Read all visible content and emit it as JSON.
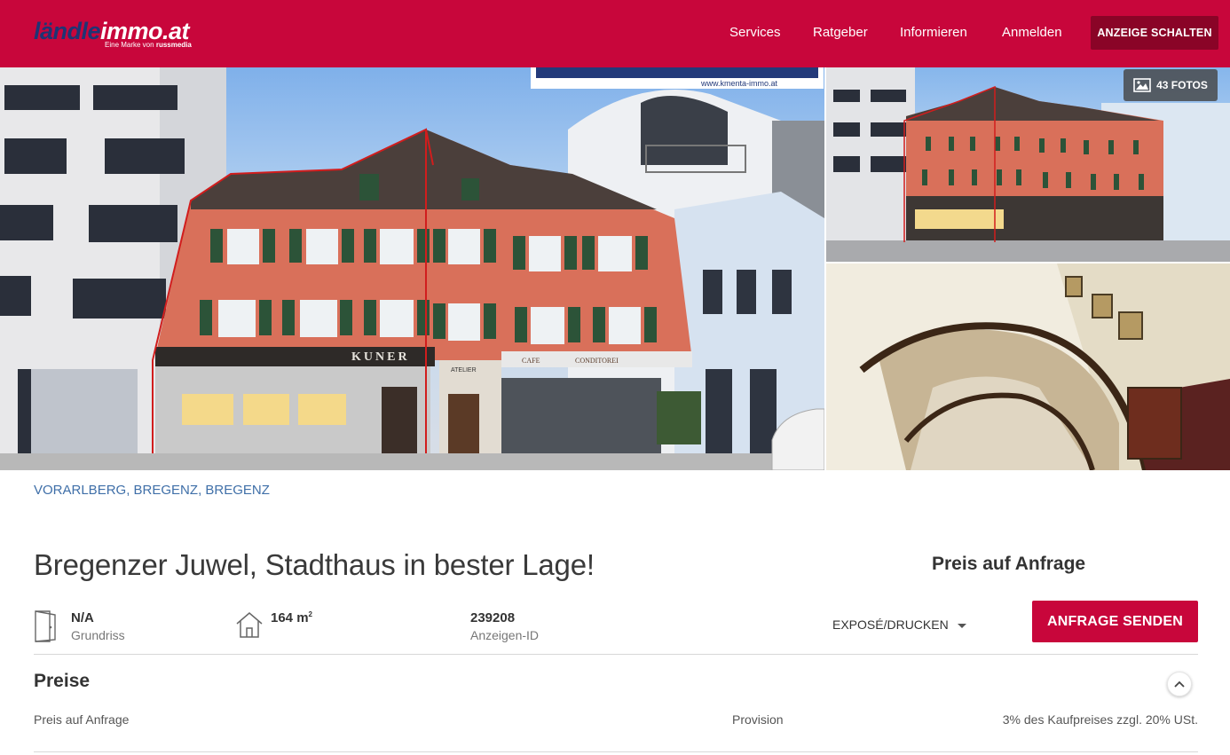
{
  "header": {
    "logo_part1": "ländle",
    "logo_part2": "immo.at",
    "logo_tagline": "Eine Marke von",
    "logo_brand": "russmedia",
    "nav": [
      "Services",
      "Ratgeber",
      "Informieren",
      "Anmelden"
    ],
    "cta_label": "ANZEIGE SCHALTEN"
  },
  "gallery": {
    "photo_count_label": "43 FOTOS",
    "sign_text": "www.kmenta-immo.at",
    "shop_sign": "KUNER",
    "cafe_sign_left": "CAFE",
    "cafe_sign_right": "CONDITOREI",
    "atelier_sign": "ATELIER"
  },
  "breadcrumb": [
    "VORARLBERG",
    "BREGENZ",
    "BREGENZ"
  ],
  "listing": {
    "title": "Bregenzer Juwel, Stadthaus in bester Lage!",
    "price_heading": "Preis auf Anfrage",
    "facts": [
      {
        "value": "N/A",
        "label": "Grundriss",
        "icon": "door-icon"
      },
      {
        "value": "164 m",
        "sup": "2",
        "label": "",
        "icon": "house-icon"
      },
      {
        "value": "239208",
        "label": "Anzeigen-ID",
        "icon": ""
      }
    ],
    "expose_label": "EXPOSÉ/DRUCKEN",
    "send_label": "ANFRAGE SENDEN"
  },
  "prices": {
    "section_title": "Preise",
    "price_text": "Preis auf Anfrage",
    "commission_label": "Provision",
    "commission_value": "3% des Kaufpreises zzgl. 20% USt."
  },
  "colors": {
    "brand": "#c8063b",
    "cta_dark": "#8a0427",
    "link": "#3f6fa8"
  }
}
